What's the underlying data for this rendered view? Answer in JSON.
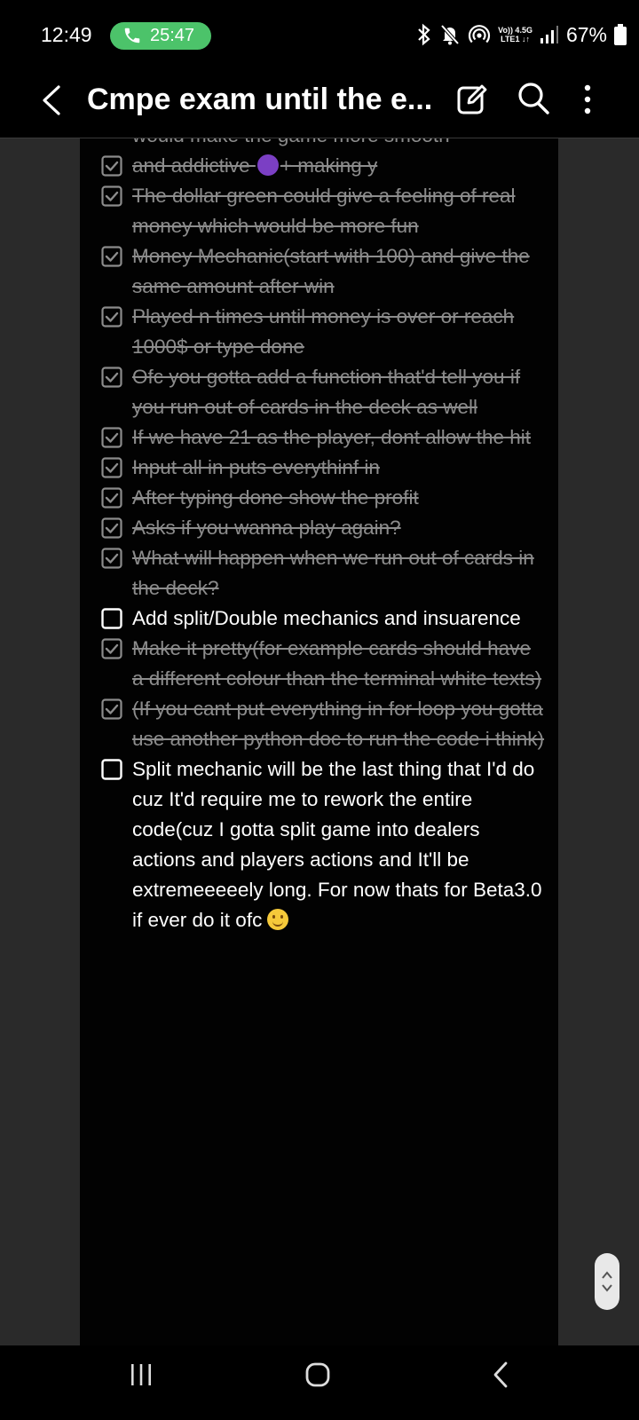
{
  "status_bar": {
    "time": "12:49",
    "call_duration": "25:47",
    "network_line1": "Vo)) 4.5G",
    "network_line2": "LTE1 ↓↑",
    "battery": "67%"
  },
  "app_bar": {
    "title": "Cmpe exam until the e..."
  },
  "note": {
    "partial_top_line": "would make the game more smooth",
    "items": [
      {
        "text": "and addictive ",
        "suffix": "+ making y",
        "checked": true
      },
      {
        "text": "The dollar green could give a feeling of real money which would be more fun",
        "checked": true
      },
      {
        "text": "Money Mechanic(start with 100) and give the same amount after win",
        "checked": true
      },
      {
        "text": "Played n times until money is over or reach 1000$ or type done",
        "checked": true
      },
      {
        "text": "Ofc you gotta add a function that'd tell you if you run out of cards in the deck as well",
        "checked": true
      },
      {
        "text": "If we have 21 as the player, dont allow the hit",
        "checked": true
      },
      {
        "text": "Input all in puts everythinf in",
        "checked": true
      },
      {
        "text": "After typing done show the profit",
        "checked": true
      },
      {
        "text": "Asks if you wanna play again?",
        "checked": true
      },
      {
        "text": "What will happen when we run out of cards in the deck?",
        "checked": true
      },
      {
        "text": "Add split/Double mechanics and insuarence",
        "checked": false
      },
      {
        "text": "Make it pretty(for example cards should have a different colour than the terminal white texts)",
        "checked": true
      },
      {
        "text": "(If you cant put everything in for loop you gotta use another python doc to run the code i think)",
        "checked": true
      },
      {
        "text": "Split mechanic will be the last thing that I'd do cuz It'd require me to rework the entire code(cuz I gotta split game into dealers actions and players actions and It'll be extremeeeeely long. For now thats for Beta3.0 if ever do it ofc",
        "checked": false
      }
    ]
  },
  "colors": {
    "call_pill": "#4cc36a",
    "checked_text": "#8c8c8c",
    "side_panel": "#2a2a2a"
  }
}
